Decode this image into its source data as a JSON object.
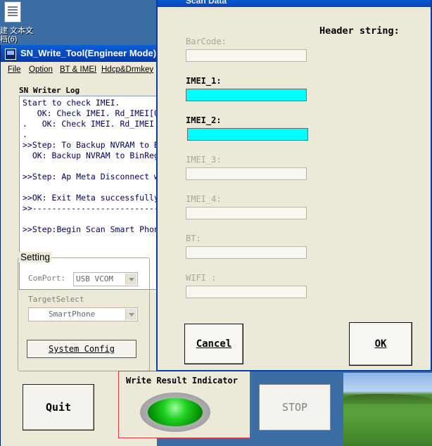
{
  "desktop": {
    "icon_label": "建 文本文\n档(6)"
  },
  "main_window": {
    "title": "SN_Write_Tool(Engineer Mode)",
    "menu": [
      {
        "label": "File"
      },
      {
        "label": "Option"
      },
      {
        "label": "BT & IMEI"
      },
      {
        "label": "Hdcp&Drmkey"
      }
    ],
    "log": {
      "label": "SN Writer Log",
      "lines": [
        "Start to check IMEI.",
        "   OK: Check IMEI. Rd_IMEI[0",
        ".   OK: Check IMEI. Rd_IMEI",
        ".",
        ">>Step: To Backup NVRAM to B",
        "  OK: Backup NVRAM to BinReg",
        "",
        ">>Step: Ap Meta Disconnect w",
        "",
        ">>OK: Exit Meta successfully",
        ">>--------------------------",
        "",
        ">>Step:Begin Scan Smart Phon"
      ]
    },
    "setting": {
      "title": "Setting",
      "comport_label": "ComPort:",
      "comport_value": "USB VCOM",
      "target_label": "TargetSelect",
      "target_value": "SmartPhone",
      "system_config": "System Config"
    },
    "quit": "Quit",
    "indicator_title": "Write Result Indicator",
    "stop": "STOP"
  },
  "dialog": {
    "title": "Scan Data",
    "header_string": "Header string:",
    "fields": [
      {
        "label": "BarCode:",
        "enabled": false,
        "value": ""
      },
      {
        "label": "IMEI_1:",
        "enabled": true,
        "value": ""
      },
      {
        "label": "IMEI_2:",
        "enabled": true,
        "value": ""
      },
      {
        "label": "IMEI_3:",
        "enabled": false,
        "value": ""
      },
      {
        "label": "IMEI_4:",
        "enabled": false,
        "value": ""
      },
      {
        "label": "BT:",
        "enabled": false,
        "value": ""
      },
      {
        "label": "WIFI :",
        "enabled": false,
        "value": ""
      }
    ],
    "cancel": "Cancel",
    "ok": "OK"
  },
  "colors": {
    "active_field": "#00ffff",
    "led": "#20d020",
    "indicator_border": "#e0383c",
    "titlebar": "#0a46b8"
  }
}
